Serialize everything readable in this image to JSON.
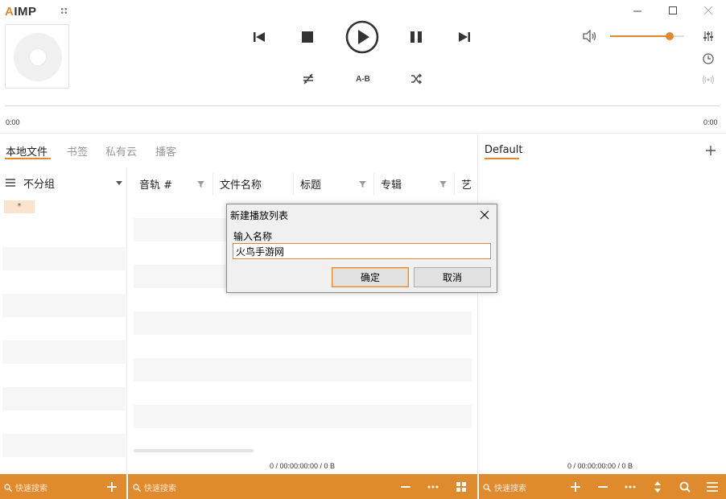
{
  "app": {
    "logo_prefix": "A",
    "logo_text": "IMP"
  },
  "player": {
    "ab_label": "A-B",
    "time_elapsed": "0:00",
    "time_remaining": "0:00",
    "volume_level_pct": 80
  },
  "source_tabs": [
    "本地文件",
    "书签",
    "私有云",
    "播客"
  ],
  "group": {
    "label": "不分组",
    "star": "*"
  },
  "columns": [
    "音轨 #",
    "文件名称",
    "标题",
    "专辑",
    "艺"
  ],
  "status_main": "0 / 00:00:00:00 / 0 B",
  "playlist": {
    "tab": "Default",
    "status": "0 / 00:00:00:00 / 0 B"
  },
  "search": {
    "placeholder_left": "快速搜索",
    "placeholder_mid": "快速搜索",
    "placeholder_right": "快速搜索"
  },
  "dialog": {
    "title": "新建播放列表",
    "label": "输入名称",
    "value": "火鸟手游网",
    "ok": "确定",
    "cancel": "取消"
  },
  "colors": {
    "accent": "#e08a2e"
  }
}
